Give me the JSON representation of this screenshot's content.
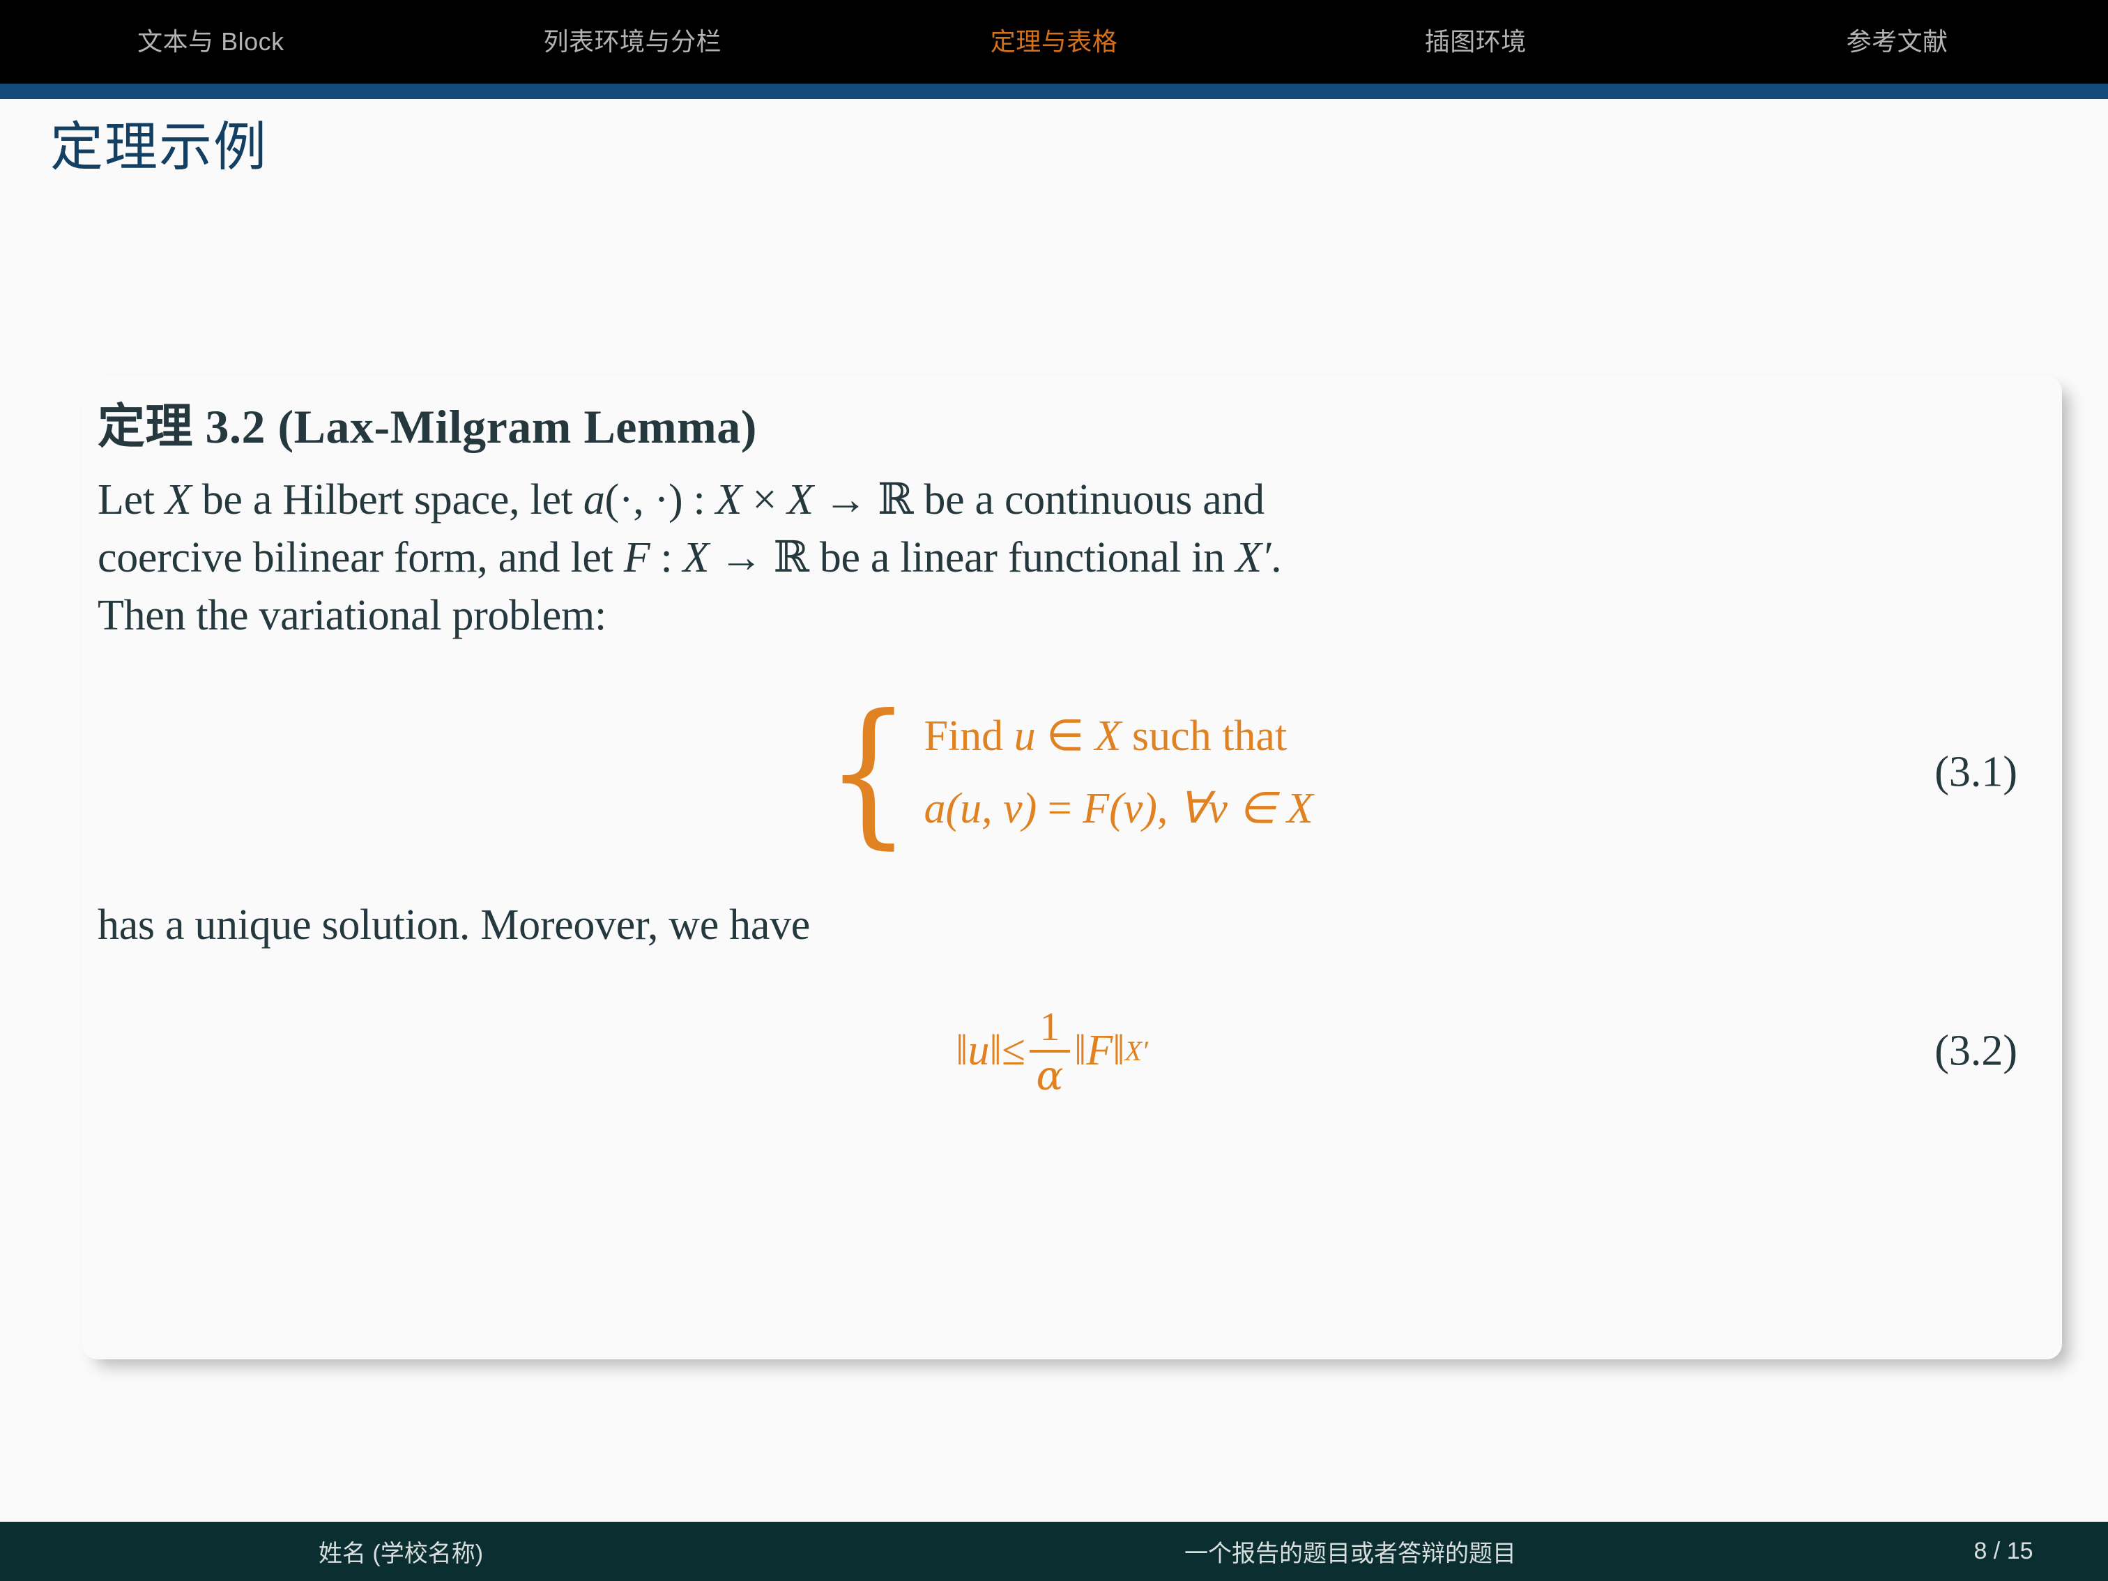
{
  "nav": {
    "items": [
      {
        "label": "文本与 Block",
        "active": false
      },
      {
        "label": "列表环境与分栏",
        "active": false
      },
      {
        "label": "定理与表格",
        "active": true
      },
      {
        "label": "插图环境",
        "active": false
      },
      {
        "label": "参考文献",
        "active": false
      }
    ],
    "background": "#000000",
    "rule_color": "#144a7c",
    "active_color": "#d4701b",
    "inactive_color": "#b3b3b3"
  },
  "slide": {
    "title": "定理示例",
    "title_color": "#133f63"
  },
  "theorem": {
    "heading_cjk": "定理",
    "heading_number": "3.2",
    "heading_name": "(Lax-Milgram Lemma)",
    "heading_full": "定理 3.2 (Lax-Milgram Lemma)",
    "line1_a": "Let ",
    "line1_X": "X",
    "line1_b": " be a Hilbert space, let ",
    "line1_a2": "a",
    "line1_c": "(·, ·) : ",
    "line1_X2": "X",
    "line1_times": " × ",
    "line1_X3": "X",
    "line1_arrow": " → ",
    "line1_R": "ℝ",
    "line1_d": " be a continuous and",
    "line2_a": "coercive bilinear form, and let ",
    "line2_F": "F",
    "line2_b": " : ",
    "line2_X": "X",
    "line2_arrow": " → ",
    "line2_R": "ℝ",
    "line2_c": " be a linear functional in ",
    "line2_Xp": "X′",
    "line2_d": ".",
    "line3": "Then the variational problem:",
    "line4": "has a unique solution.  Moreover, we have",
    "text_color": "#24383d"
  },
  "equation_31": {
    "brace": "{",
    "case1_find": "Find ",
    "case1_u": "u",
    "case1_in": " ∈ ",
    "case1_X": "X",
    "case1_tail": " such that",
    "case2_a": "a",
    "case2_args": "(u, v)",
    "case2_eq": " = ",
    "case2_F": "F",
    "case2_v": "(v)",
    "case2_comma": ", ",
    "case2_forall": "∀v ∈ X",
    "number": "(3.1)",
    "color": "#e08122"
  },
  "equation_32": {
    "norm_u": "‖u‖",
    "leq": " ≤ ",
    "frac_num": "1",
    "frac_den": "α",
    "norm_F": "‖F‖",
    "norm_F_sub": "X′",
    "number": "(3.2)",
    "color": "#e08122"
  },
  "footer": {
    "author": "姓名 (学校名称)",
    "title": "一个报告的题目或者答辩的题目",
    "page": "8 / 15",
    "background": "#0b2e31",
    "text_color": "#d8dede"
  }
}
